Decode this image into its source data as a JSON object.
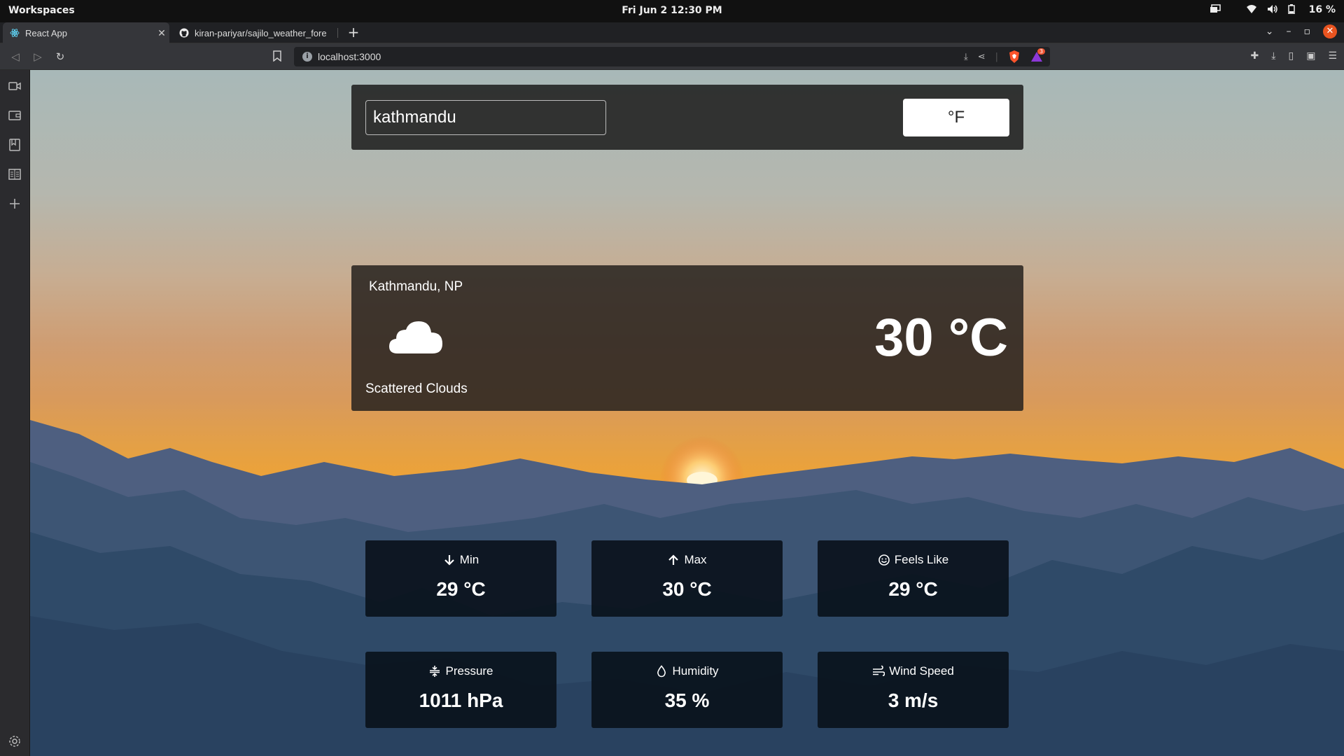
{
  "system": {
    "workspaces_label": "Workspaces",
    "clock": "Fri Jun 2  12:30 PM",
    "battery": "16 %"
  },
  "browser": {
    "tabs": [
      {
        "title": "React App",
        "favicon": "react-icon",
        "active": true
      },
      {
        "title": "kiran-pariyar/sajilo_weather_fore",
        "favicon": "github-icon",
        "active": false
      }
    ],
    "url": "localhost:3000",
    "rewards_badge": "3"
  },
  "app": {
    "search": {
      "value": "kathmandu"
    },
    "unit_toggle_label": "°F",
    "current": {
      "location": "Kathmandu, NP",
      "temperature": "30 °C",
      "description": "Scattered Clouds",
      "icon": "cloud-icon"
    },
    "stats": [
      {
        "label": "Min",
        "value": "29 °C",
        "icon": "arrow-down-icon"
      },
      {
        "label": "Max",
        "value": "30 °C",
        "icon": "arrow-up-icon"
      },
      {
        "label": "Feels Like",
        "value": "29 °C",
        "icon": "smile-icon"
      },
      {
        "label": "Pressure",
        "value": "1011 hPa",
        "icon": "compress-icon"
      },
      {
        "label": "Humidity",
        "value": "35 %",
        "icon": "droplet-icon"
      },
      {
        "label": "Wind Speed",
        "value": "3 m/s",
        "icon": "wind-icon"
      }
    ]
  },
  "colors": {
    "accent_close": "#e95420",
    "card_dark": "#0a121c"
  }
}
